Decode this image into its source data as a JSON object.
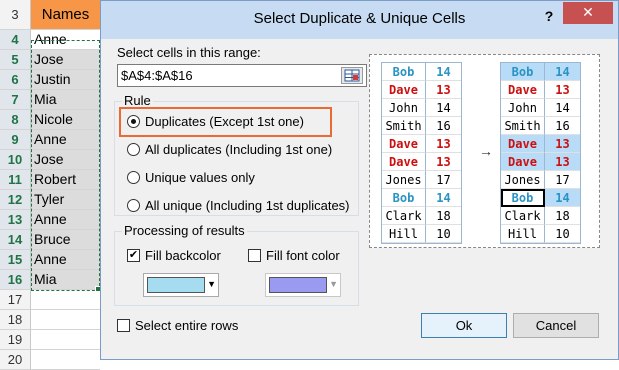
{
  "sheet": {
    "header_row": "3",
    "header": "Names",
    "rows": [
      {
        "num": "4",
        "value": "Anne"
      },
      {
        "num": "5",
        "value": "Jose"
      },
      {
        "num": "6",
        "value": "Justin"
      },
      {
        "num": "7",
        "value": "Mia"
      },
      {
        "num": "8",
        "value": "Nicole"
      },
      {
        "num": "9",
        "value": "Anne"
      },
      {
        "num": "10",
        "value": "Jose"
      },
      {
        "num": "11",
        "value": "Robert"
      },
      {
        "num": "12",
        "value": "Tyler"
      },
      {
        "num": "13",
        "value": "Anne"
      },
      {
        "num": "14",
        "value": "Bruce"
      },
      {
        "num": "15",
        "value": "Anne"
      },
      {
        "num": "16",
        "value": "Mia"
      },
      {
        "num": "17",
        "value": ""
      },
      {
        "num": "18",
        "value": ""
      },
      {
        "num": "19",
        "value": ""
      },
      {
        "num": "20",
        "value": ""
      }
    ]
  },
  "dialog": {
    "title": "Select Duplicate & Unique Cells",
    "help_label": "?",
    "close_label": "✕",
    "range_label": "Select cells in this range:",
    "range_value": "$A$4:$A$16",
    "rule_title": "Rule",
    "rules": [
      {
        "label": "Duplicates (Except 1st one)",
        "selected": true
      },
      {
        "label": "All duplicates (Including 1st one)",
        "selected": false
      },
      {
        "label": "Unique values only",
        "selected": false
      },
      {
        "label": "All unique (Including 1st duplicates)",
        "selected": false
      }
    ],
    "processing_title": "Processing of results",
    "fill_backcolor_label": "Fill backcolor",
    "fill_backcolor_checked": true,
    "fill_font_label": "Fill font color",
    "fill_font_checked": false,
    "backcolor": "#a6dcf0",
    "fontcolor": "#9a9af0",
    "select_rows_label": "Select entire rows",
    "ok_label": "Ok",
    "cancel_label": "Cancel",
    "check_mark": "✔",
    "dropdown_arrow": "▼",
    "preview_arrow": "→",
    "preview_before": [
      {
        "name": "Bob",
        "val": "14",
        "color": "blue"
      },
      {
        "name": "Dave",
        "val": "13",
        "color": "red"
      },
      {
        "name": "John",
        "val": "14",
        "color": ""
      },
      {
        "name": "Smith",
        "val": "16",
        "color": ""
      },
      {
        "name": "Dave",
        "val": "13",
        "color": "red"
      },
      {
        "name": "Dave",
        "val": "13",
        "color": "red"
      },
      {
        "name": "Jones",
        "val": "17",
        "color": ""
      },
      {
        "name": "Bob",
        "val": "14",
        "color": "blue"
      },
      {
        "name": "Clark",
        "val": "18",
        "color": ""
      },
      {
        "name": "Hill",
        "val": "10",
        "color": ""
      }
    ],
    "preview_after": [
      {
        "name": "Bob",
        "val": "14",
        "color": "blue",
        "hl": true
      },
      {
        "name": "Dave",
        "val": "13",
        "color": "red",
        "hl": false
      },
      {
        "name": "John",
        "val": "14",
        "color": "",
        "hl": false
      },
      {
        "name": "Smith",
        "val": "16",
        "color": "",
        "hl": false
      },
      {
        "name": "Dave",
        "val": "13",
        "color": "red",
        "hl": true
      },
      {
        "name": "Dave",
        "val": "13",
        "color": "red",
        "hl": true
      },
      {
        "name": "Jones",
        "val": "17",
        "color": "",
        "hl": false
      },
      {
        "name": "Bob",
        "val": "14",
        "color": "blue",
        "hl": true
      },
      {
        "name": "Clark",
        "val": "18",
        "color": "",
        "hl": false
      },
      {
        "name": "Hill",
        "val": "10",
        "color": "",
        "hl": false
      }
    ]
  }
}
